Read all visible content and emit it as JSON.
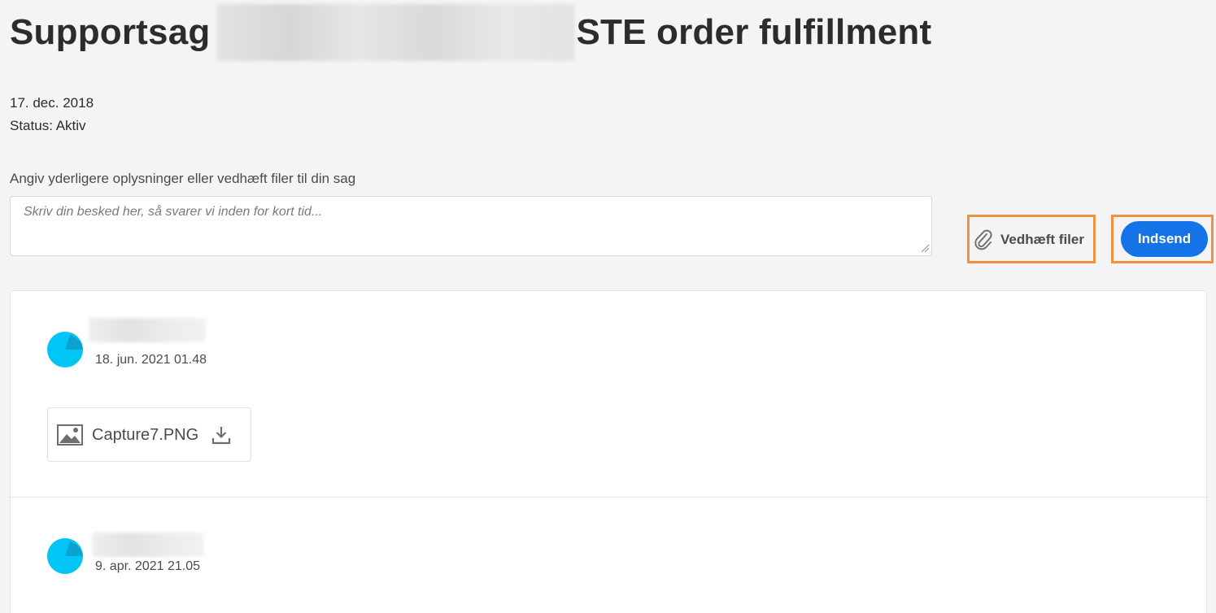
{
  "case": {
    "title_prefix": "Supportsag",
    "title_suffix": "STE order fulfillment",
    "date": "17. dec. 2018",
    "status": "Status: Aktiv"
  },
  "composer": {
    "label": "Angiv yderligere oplysninger eller vedhæft filer til din sag",
    "placeholder": "Skriv din besked her, så svarer vi inden for kort tid...",
    "attach_label": "Vedhæft filer",
    "submit_label": "Indsend"
  },
  "colors": {
    "accent": "#1473e6",
    "highlight": "#f0923e",
    "avatar": "#00c5f5",
    "avatar_shade": "#0aa3d0"
  },
  "thread": {
    "messages": [
      {
        "timestamp": "18. jun. 2021 01.48",
        "attachment": {
          "icon": "image-icon",
          "name": "Capture7.PNG",
          "action_icon": "download-icon"
        }
      },
      {
        "timestamp": "9. apr. 2021 21.05"
      }
    ]
  }
}
